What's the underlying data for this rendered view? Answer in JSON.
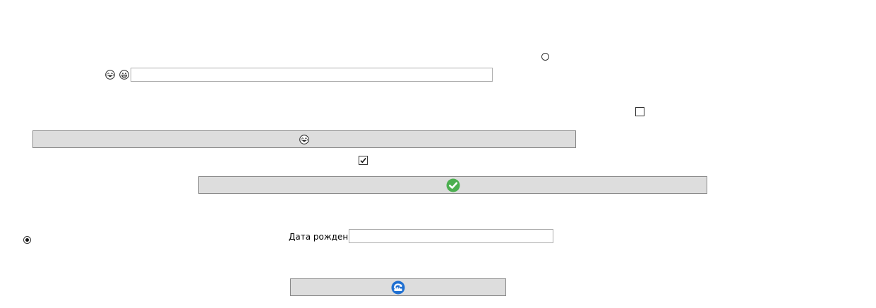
{
  "form": {
    "birth_date_label": "Дата рождения",
    "birth_date_value": "",
    "top_text_value": ""
  },
  "controls": {
    "radio_top_checked": false,
    "radio_bottom_checked": true,
    "checkbox_top_checked": false,
    "checkbox_middle_checked": true
  },
  "icons": {
    "top_left_1": "laughing-face-icon",
    "top_left_2": "grinning-face-icon",
    "button_1": "laughing-face-icon",
    "button_2": "green-check-circle-icon",
    "button_3": "blue-refresh-icon"
  },
  "colors": {
    "button_bg": "#dddddd",
    "button_border": "#8a8a8a",
    "textbox_border": "#adadad",
    "check_green": "#4caf50",
    "refresh_blue": "#1e6fd1"
  }
}
